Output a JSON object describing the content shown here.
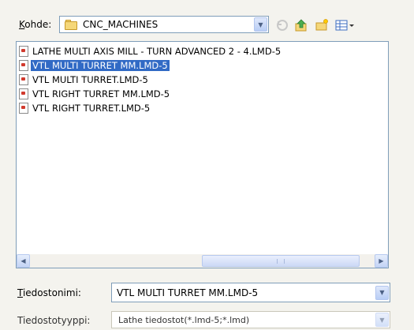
{
  "look_in": {
    "label_prefix": "",
    "label_access": "K",
    "label_rest": "ohde:",
    "value": "CNC_MACHINES"
  },
  "toolbar": {
    "icons": [
      "back-icon",
      "up-folder-icon",
      "new-folder-icon",
      "views-menu-icon"
    ]
  },
  "files": [
    {
      "name": "LATHE MULTI  AXIS  MILL - TURN  ADVANCED 2 - 4.LMD-5",
      "selected": false
    },
    {
      "name": "VTL MULTI TURRET MM.LMD-5",
      "selected": true
    },
    {
      "name": "VTL MULTI TURRET.LMD-5",
      "selected": false
    },
    {
      "name": "VTL RIGHT TURRET MM.LMD-5",
      "selected": false
    },
    {
      "name": "VTL RIGHT TURRET.LMD-5",
      "selected": false
    }
  ],
  "filename": {
    "label_access": "T",
    "label_rest": "iedostonimi:",
    "value": "VTL MULTI TURRET MM.LMD-5"
  },
  "filetype": {
    "label": "Tiedostotyyppi:",
    "value": "Lathe tiedostot(*.lmd-5;*.lmd)"
  },
  "colors": {
    "selection": "#316ac5",
    "border": "#7f9db9",
    "background": "#f4f3ee"
  }
}
